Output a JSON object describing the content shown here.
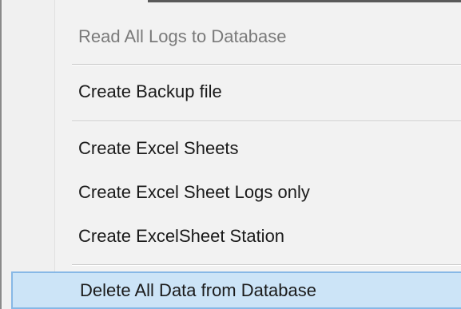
{
  "menu": {
    "items": [
      {
        "label": "Read All Logs to Database",
        "state": "disabled"
      },
      {
        "label": "Create Backup file",
        "state": "normal"
      },
      {
        "label": "Create Excel Sheets",
        "state": "normal"
      },
      {
        "label": "Create Excel Sheet Logs only",
        "state": "normal"
      },
      {
        "label": "Create ExcelSheet Station",
        "state": "normal"
      },
      {
        "label": "Delete All Data from Database",
        "state": "highlighted"
      }
    ]
  },
  "colors": {
    "menu_background": "#f2f2f2",
    "highlight_fill": "#cce4f7",
    "highlight_border": "#87b8e6",
    "disabled_text": "#7a7a7a",
    "text": "#1a1a1a"
  }
}
